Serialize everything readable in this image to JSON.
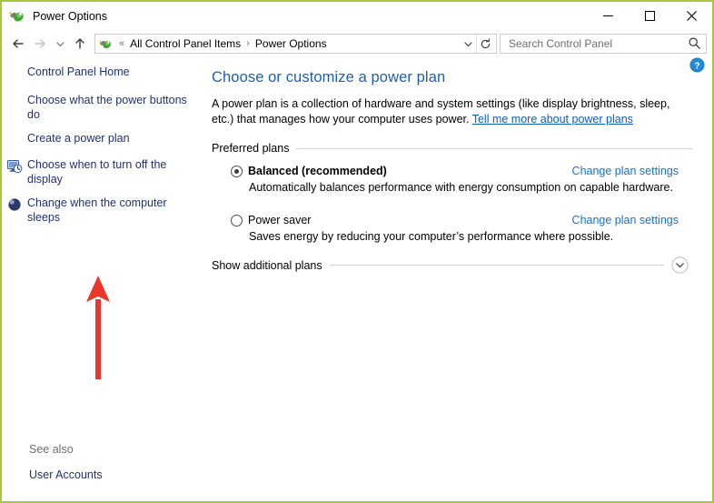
{
  "window": {
    "title": "Power Options",
    "icon": "power-plug-icon",
    "border_color": "#A4C83C",
    "controls": {
      "minimize": "—",
      "maximize": "□",
      "close": "✕"
    }
  },
  "navbar": {
    "back": "←",
    "forward": "→",
    "recent": "⌄",
    "up": "↑",
    "breadcrumb": {
      "icon": "power-plug-icon",
      "overflow": "«",
      "items": [
        "All Control Panel Items",
        "Power Options"
      ],
      "separator": "›"
    },
    "dropdown": "⌄",
    "refresh": "↻",
    "search": {
      "placeholder": "Search Control Panel",
      "value": "",
      "icon": "search-icon"
    }
  },
  "sidebar": {
    "items": [
      {
        "label": "Control Panel Home",
        "icon": null
      },
      {
        "label": "Choose what the power buttons do",
        "icon": null
      },
      {
        "label": "Create a power plan",
        "icon": null
      },
      {
        "label": "Choose when to turn off the display",
        "icon": "display-clock-icon"
      },
      {
        "label": "Change when the computer sleeps",
        "icon": "sleep-moon-icon"
      }
    ],
    "see_also_label": "See also",
    "see_also_link": "User Accounts"
  },
  "annotation": {
    "arrow": "red-up-arrow",
    "color": "#E8382C"
  },
  "main": {
    "help_icon": "help-question-icon",
    "title": "Choose or customize a power plan",
    "intro_text": "A power plan is a collection of hardware and system settings (like display brightness, sleep, etc.) that manages how your computer uses power. ",
    "intro_link": "Tell me more about power plans",
    "preferred_plans_label": "Preferred plans",
    "plans": [
      {
        "name": "Balanced (recommended)",
        "selected": true,
        "bold": true,
        "description": "Automatically balances performance with energy consumption on capable hardware.",
        "change_link": "Change plan settings"
      },
      {
        "name": "Power saver",
        "selected": false,
        "bold": false,
        "description": "Saves energy by reducing your computer’s performance where possible.",
        "change_link": "Change plan settings"
      }
    ],
    "additional_plans_label": "Show additional plans",
    "expand_icon": "chevron-down-circle-icon"
  },
  "colors": {
    "accent_border": "#A4C83C",
    "heading_blue": "#1F5FA9",
    "link_blue": "#1672C8",
    "sidebar_link": "#22316E",
    "annotation_red": "#E8382C"
  }
}
